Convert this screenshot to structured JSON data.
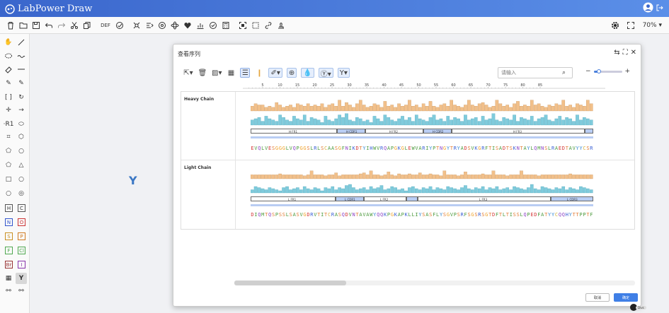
{
  "app": {
    "title": "LabPower Draw"
  },
  "toolbar": {
    "def_label": "DEF",
    "zoom": "70%"
  },
  "dialog": {
    "title": "查看序列",
    "search_placeholder": "请输入",
    "cancel_label": "取消",
    "ok_label": "确定"
  },
  "ruler": {
    "ticks": [
      "5",
      "10",
      "15",
      "20",
      "25",
      "30",
      "35",
      "40",
      "45",
      "50",
      "55",
      "60",
      "65",
      "70",
      "75",
      "80",
      "85"
    ]
  },
  "colors": {
    "accent": "#3f7fe6",
    "bar_orange": "#f2c08a",
    "bar_cyan": "#7fcbdc",
    "region_fill": "#b9cdf3",
    "heading_blue": "#3a66cc"
  },
  "chains": [
    {
      "name": "Heavy Chain",
      "regions": [
        {
          "label": "H FR1",
          "type": "fr"
        },
        {
          "label": "H CDR1",
          "type": "cdr"
        },
        {
          "label": "H FR2",
          "type": "fr"
        },
        {
          "label": "H CDR2",
          "type": "cdr"
        },
        {
          "label": "H FR3",
          "type": "fr"
        },
        {
          "label": "",
          "type": "cdr"
        }
      ],
      "sequence": "EVQLVESGGGLVQPGGSLRLSCAASGFNIKDTYIHWVRQAPGKGLEWVARIYPTNGYTRYADSVKGRFTISADTSKNTAYLQMNSLRAEDTAVYYCSR",
      "bar_orange": [
        0.4,
        0.6,
        0.5,
        0.5,
        0.3,
        0.4,
        0.3,
        0.7,
        0.5,
        0.3,
        0.4,
        0.5,
        0.3,
        0.6,
        0.5,
        0.4,
        0.6,
        0.4,
        0.5,
        0.4,
        0.6,
        0.3,
        0.5,
        0.6,
        0.4,
        0.9,
        0.4,
        0.7,
        0.5,
        0.3,
        0.6,
        0.9,
        0.5,
        0.3,
        0.4,
        0.6,
        0.5,
        0.3,
        0.8,
        0.4,
        0.5,
        0.3,
        0.6,
        0.4,
        0.5,
        0.9,
        0.4,
        0.5,
        0.3,
        0.6,
        0.4,
        0.8,
        0.4,
        0.3,
        0.5,
        0.6,
        0.4,
        0.9,
        0.5,
        0.4,
        0.3,
        0.5,
        0.9,
        0.5,
        0.4,
        0.6,
        0.7,
        0.5,
        0.3,
        0.4,
        0.9,
        0.6,
        0.4,
        0.5,
        0.3,
        0.6,
        0.8,
        0.4,
        0.5,
        0.4,
        0.9,
        0.5,
        0.6,
        0.4,
        0.3,
        0.5,
        0.4,
        0.6,
        0.5,
        0.9,
        0.4,
        0.5,
        0.3,
        0.6,
        0.5,
        0.4,
        0.9,
        0.6
      ],
      "bar_cyan": [
        0.4,
        0.5,
        0.6,
        0.3,
        0.7,
        0.5,
        0.4,
        0.3,
        0.8,
        0.6,
        0.4,
        0.3,
        0.7,
        0.5,
        0.4,
        0.8,
        0.3,
        0.6,
        0.5,
        0.4,
        0.2,
        0.7,
        0.4,
        0.3,
        0.5,
        0.8,
        0.6,
        0.9,
        0.4,
        0.3,
        0.6,
        0.5,
        0.3,
        0.4,
        0.2,
        0.7,
        0.5,
        0.3,
        0.8,
        0.6,
        0.4,
        0.3,
        0.5,
        0.7,
        0.4,
        0.6,
        0.3,
        0.8,
        0.5,
        0.4,
        0.3,
        0.6,
        0.8,
        0.4,
        0.5,
        0.3,
        0.7,
        0.4,
        0.6,
        0.5,
        0.3,
        0.8,
        0.4,
        0.5,
        0.6,
        0.3,
        0.7,
        0.4,
        0.5,
        0.9,
        0.4,
        0.3,
        0.6,
        0.5,
        0.4,
        0.8,
        0.3,
        0.6,
        0.5,
        0.4,
        0.7,
        0.3,
        0.5,
        0.6,
        0.8,
        0.4,
        0.3,
        0.5,
        0.7,
        0.4,
        0.6,
        0.5,
        0.3,
        0.8,
        0.4,
        0.6,
        0.5,
        0.4
      ]
    },
    {
      "name": "Light Chain",
      "regions": [
        {
          "label": "L FR1",
          "type": "fr"
        },
        {
          "label": "L CDR1",
          "type": "cdr"
        },
        {
          "label": "L FR2",
          "type": "fr"
        },
        {
          "label": "",
          "type": "cdr"
        },
        {
          "label": "L FR3",
          "type": "fr"
        },
        {
          "label": "L CDR3",
          "type": "cdr"
        }
      ],
      "sequence": "DIQMTQSPSSLSASVGDRVTITCRASQDVNTAVAWYQQKPGKAPKLLIYSASFLYSGVPSRFSGSRSGTDFTLTISSLQPEDFATYYCQQHYTTPPTF",
      "bar_orange": [
        0.4,
        0.4,
        0.4,
        0.4,
        0.4,
        0.4,
        0.4,
        0.4,
        0.5,
        0.4,
        0.4,
        0.4,
        0.4,
        0.4,
        0.4,
        0.3,
        0.4,
        0.8,
        0.4,
        0.4,
        0.4,
        0.3,
        0.4,
        0.4,
        0.6,
        0.3,
        0.4,
        0.4,
        0.4,
        0.4,
        0.4,
        0.5,
        0.6,
        0.4,
        0.8,
        0.4,
        0.4,
        0.3,
        0.4,
        0.7,
        0.4,
        0.3,
        0.5,
        0.4,
        0.4,
        0.5,
        0.4,
        0.4,
        0.6,
        0.4,
        0.4,
        0.5,
        0.4,
        0.4,
        0.3,
        0.8,
        0.4,
        0.4,
        0.4,
        0.3,
        0.4,
        0.7,
        0.4,
        0.4,
        0.4,
        0.4,
        0.5,
        0.4,
        0.4,
        0.8,
        0.4,
        0.4,
        0.4,
        0.3,
        0.4,
        0.4,
        0.4,
        0.8,
        0.4,
        0.4,
        0.4,
        0.4,
        0.3,
        0.4,
        0.4,
        0.4,
        0.4,
        0.4,
        0.4,
        0.4,
        0.4,
        0.5,
        0.4,
        0.4,
        0.4,
        0.4,
        0.4,
        0.4
      ],
      "bar_cyan": [
        0.3,
        0.6,
        0.5,
        0.4,
        0.3,
        0.5,
        0.4,
        0.3,
        0.2,
        0.5,
        0.6,
        0.3,
        0.4,
        0.5,
        0.3,
        0.6,
        0.4,
        0.3,
        0.5,
        0.4,
        0.2,
        0.5,
        0.4,
        0.6,
        0.3,
        0.5,
        0.4,
        0.7,
        0.8,
        0.5,
        0.3,
        0.4,
        0.5,
        0.3,
        0.6,
        0.4,
        0.5,
        0.7,
        0.3,
        0.4,
        0.6,
        0.5,
        0.3,
        0.4,
        0.2,
        0.5,
        0.6,
        0.4,
        0.3,
        0.5,
        0.4,
        0.6,
        0.3,
        0.5,
        0.4,
        0.3,
        0.6,
        0.5,
        0.4,
        0.3,
        0.5,
        0.7,
        0.4,
        0.3,
        0.5,
        0.4,
        0.6,
        0.3,
        0.5,
        0.4,
        0.6,
        0.3,
        0.4,
        0.5,
        0.3,
        0.6,
        0.5,
        0.4,
        0.3,
        0.5,
        0.8,
        0.4,
        0.3,
        0.6,
        0.5,
        0.4,
        0.3,
        0.5,
        0.4,
        0.6,
        0.3,
        0.5,
        0.4,
        0.3,
        0.6,
        0.5,
        0.4,
        0.3
      ]
    }
  ]
}
